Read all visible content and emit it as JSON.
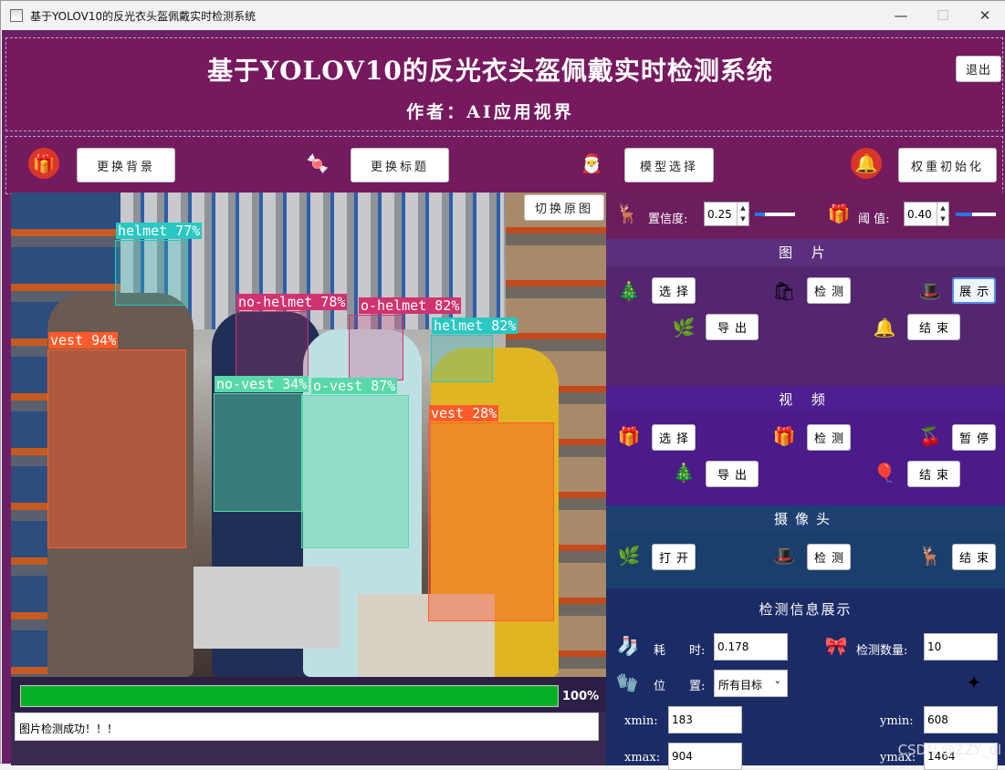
{
  "window": {
    "title": "基于YOLOV10的反光衣头盔佩戴实时检测系统",
    "minimize": "—",
    "maximize": "☐",
    "close": "✕"
  },
  "header": {
    "title": "基于YOLOV10的反光衣头盔佩戴实时检测系统",
    "author": "作者：AI应用视界",
    "exit": "退出"
  },
  "toolbar": {
    "change_bg": "更换背景",
    "change_title": "更换标题",
    "model_select": "模型选择",
    "weight_init": "权重初始化"
  },
  "image_panel": {
    "switch_label": "切换原图",
    "detections": [
      {
        "label": "helmet 77%",
        "color": "#2bc7c2"
      },
      {
        "label": "no-helmet 78%",
        "color": "#d0336f"
      },
      {
        "label": "o-helmet 82%",
        "color": "#d0336f"
      },
      {
        "label": "helmet 82%",
        "color": "#2bc7c2"
      },
      {
        "label": "vest 94%",
        "color": "#ff5b2a"
      },
      {
        "label": "no-vest 34%",
        "color": "#59d9a8"
      },
      {
        "label": "o-vest 87%",
        "color": "#59d9a8"
      },
      {
        "label": "vest 28%",
        "color": "#ff5b2a"
      }
    ]
  },
  "progress": {
    "value": 1.0,
    "text": "100%"
  },
  "status": "图片检测成功！！！",
  "params": {
    "conf_label": "置信度:",
    "conf_value": "0.25",
    "conf_fraction": 0.25,
    "iou_label": "阈 值:",
    "iou_value": "0.40",
    "iou_fraction": 0.4
  },
  "image_section": {
    "title": "图 片",
    "select": "选择",
    "detect": "检测",
    "show": "展示",
    "export": "导出",
    "end": "结束"
  },
  "video_section": {
    "title": "视 频",
    "select": "选择",
    "detect": "检测",
    "pause": "暂停",
    "export": "导出",
    "end": "结束"
  },
  "camera_section": {
    "title": "摄像头",
    "open": "打开",
    "detect": "检测",
    "end": "结束"
  },
  "info_section": {
    "title": "检测信息展示",
    "time_label": "耗　　时:",
    "time_value": "0.178",
    "count_label": "检测数量:",
    "count_value": "10",
    "pos_label": "位　　置:",
    "pos_value": "所有目标",
    "xmin_label": "xmin:",
    "xmin": "183",
    "ymin_label": "ymin:",
    "ymin": "608",
    "xmax_label": "xmax:",
    "xmax": "904",
    "ymax_label": "ymax:",
    "ymax": "1464"
  },
  "watermark": "CSDN @ZZY_dl",
  "colors": {
    "header": "#76195f",
    "image_sec": "#53266f",
    "video_sec": "#4b1b8a",
    "camera_sec": "#1a3f6d",
    "info_sec": "#1b2b66"
  }
}
